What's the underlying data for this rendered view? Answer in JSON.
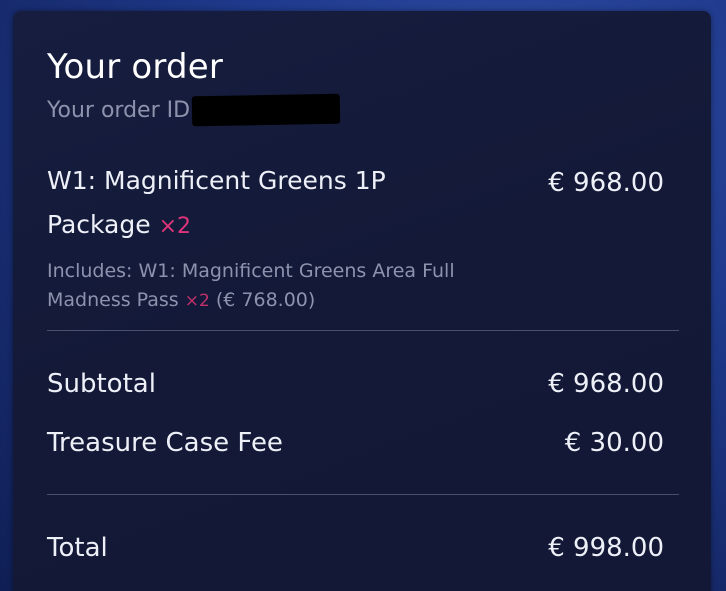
{
  "order": {
    "title": "Your order",
    "order_id_label": "Your order ID",
    "item": {
      "name": "W1: Magnificent Greens 1P Package",
      "quantity": "×2",
      "price": "€ 968.00",
      "includes_prefix": "Includes: W1: Magnificent Greens Area Full Madness Pass",
      "includes_quantity": "×2",
      "includes_price": "(€ 768.00)"
    },
    "subtotal": {
      "label": "Subtotal",
      "value": "€ 968.00"
    },
    "fee": {
      "label": "Treasure Case Fee",
      "value": "€ 30.00"
    },
    "total": {
      "label": "Total",
      "value": "€ 998.00"
    }
  },
  "colors": {
    "panel_bg": "#141a39",
    "text": "#eef0f8",
    "muted": "#8e93ad",
    "quantity_accent": "#e0357a",
    "page_bg": "#1f3a8c"
  }
}
